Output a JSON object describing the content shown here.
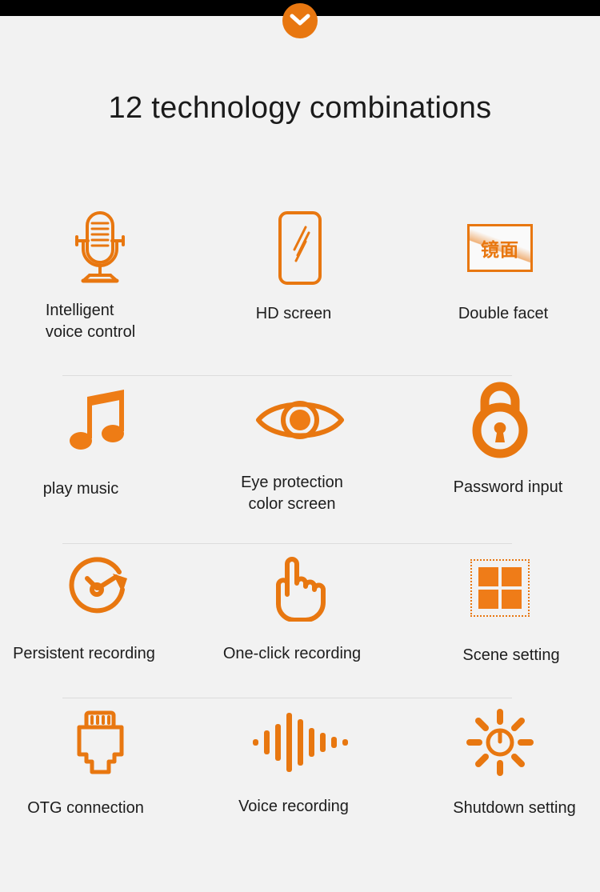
{
  "topbar": {
    "chevron_icon": "chevron-down-icon"
  },
  "heading": {
    "title": "12 technology combinations"
  },
  "mirror_tile": {
    "text": "镜面"
  },
  "features": [
    [
      {
        "icon": "microphone-icon",
        "label": "Intelligent\nvoice control"
      },
      {
        "icon": "phone-screen-icon",
        "label": "HD screen"
      },
      {
        "icon": "mirror-panel-icon",
        "label": "Double facet"
      }
    ],
    [
      {
        "icon": "music-note-icon",
        "label": "play music"
      },
      {
        "icon": "eye-icon",
        "label": "Eye protection\ncolor screen"
      },
      {
        "icon": "padlock-icon",
        "label": "Password input"
      }
    ],
    [
      {
        "icon": "clock-refresh-icon",
        "label": "Persistent recording"
      },
      {
        "icon": "pointing-hand-icon",
        "label": "One-click recording"
      },
      {
        "icon": "grid-squares-icon",
        "label": "Scene setting"
      }
    ],
    [
      {
        "icon": "usb-connector-icon",
        "label": "OTG connection"
      },
      {
        "icon": "waveform-icon",
        "label": "Voice recording"
      },
      {
        "icon": "power-rays-icon",
        "label": "Shutdown setting"
      }
    ]
  ],
  "colors": {
    "accent": "#e87710",
    "background": "#f2f2f2",
    "text": "#1d1d1d",
    "topbar": "#000000",
    "separator": "#dcdcdc"
  },
  "waveform_bar_heights": [
    8,
    30,
    46,
    70,
    58,
    36,
    24,
    14,
    8
  ]
}
